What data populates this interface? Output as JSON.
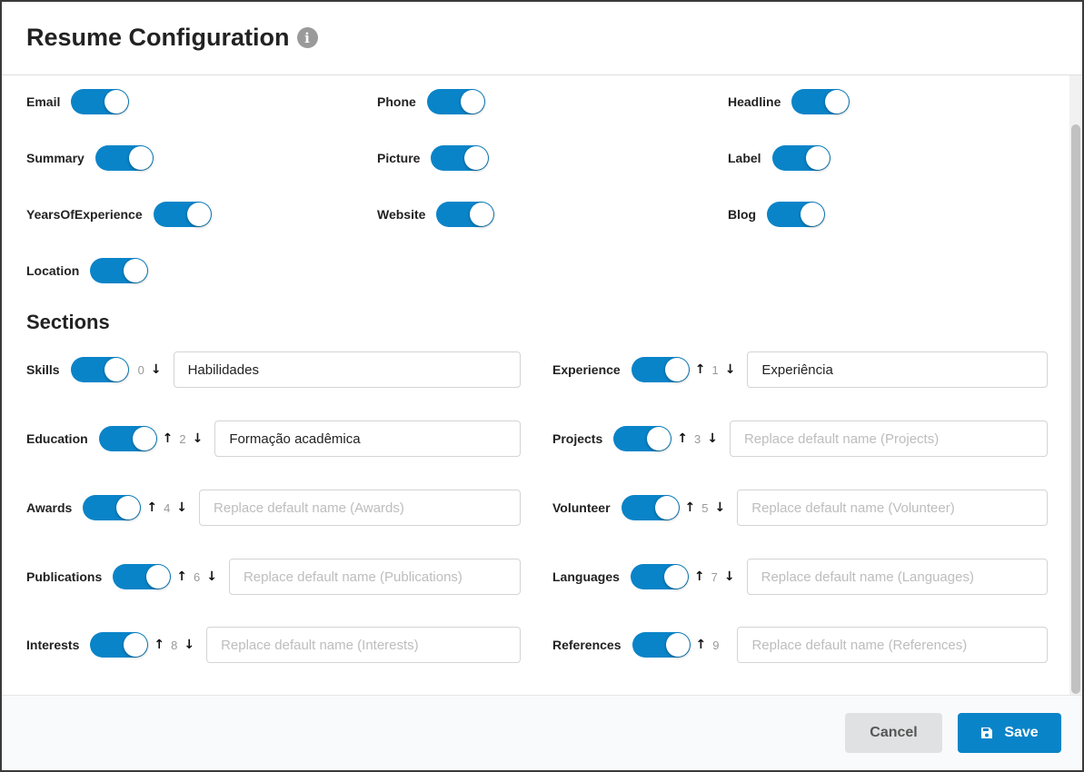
{
  "header": {
    "title": "Resume Configuration",
    "info_icon": "info-icon"
  },
  "fields": [
    {
      "label": "Email",
      "enabled": true
    },
    {
      "label": "Phone",
      "enabled": true
    },
    {
      "label": "Headline",
      "enabled": true
    },
    {
      "label": "Summary",
      "enabled": true
    },
    {
      "label": "Picture",
      "enabled": true
    },
    {
      "label": "Label",
      "enabled": true
    },
    {
      "label": "YearsOfExperience",
      "enabled": true
    },
    {
      "label": "Website",
      "enabled": true
    },
    {
      "label": "Blog",
      "enabled": true
    },
    {
      "label": "Location",
      "enabled": true
    }
  ],
  "sections_title": "Sections",
  "sections": [
    {
      "label": "Skills",
      "order": "0",
      "value": "Habilidades",
      "placeholder": ""
    },
    {
      "label": "Experience",
      "order": "1",
      "value": "Experiência",
      "placeholder": ""
    },
    {
      "label": "Education",
      "order": "2",
      "value": "Formação acadêmica",
      "placeholder": ""
    },
    {
      "label": "Projects",
      "order": "3",
      "value": "",
      "placeholder": "Replace default name (Projects)"
    },
    {
      "label": "Awards",
      "order": "4",
      "value": "",
      "placeholder": "Replace default name (Awards)"
    },
    {
      "label": "Volunteer",
      "order": "5",
      "value": "",
      "placeholder": "Replace default name (Volunteer)"
    },
    {
      "label": "Publications",
      "order": "6",
      "value": "",
      "placeholder": "Replace default name (Publications)"
    },
    {
      "label": "Languages",
      "order": "7",
      "value": "",
      "placeholder": "Replace default name (Languages)"
    },
    {
      "label": "Interests",
      "order": "8",
      "value": "",
      "placeholder": "Replace default name (Interests)"
    },
    {
      "label": "References",
      "order": "9",
      "value": "",
      "placeholder": "Replace default name (References)"
    }
  ],
  "footer": {
    "cancel_label": "Cancel",
    "save_label": "Save"
  },
  "colors": {
    "accent": "#0a84c8",
    "cancel_bg": "#e0e1e2"
  }
}
